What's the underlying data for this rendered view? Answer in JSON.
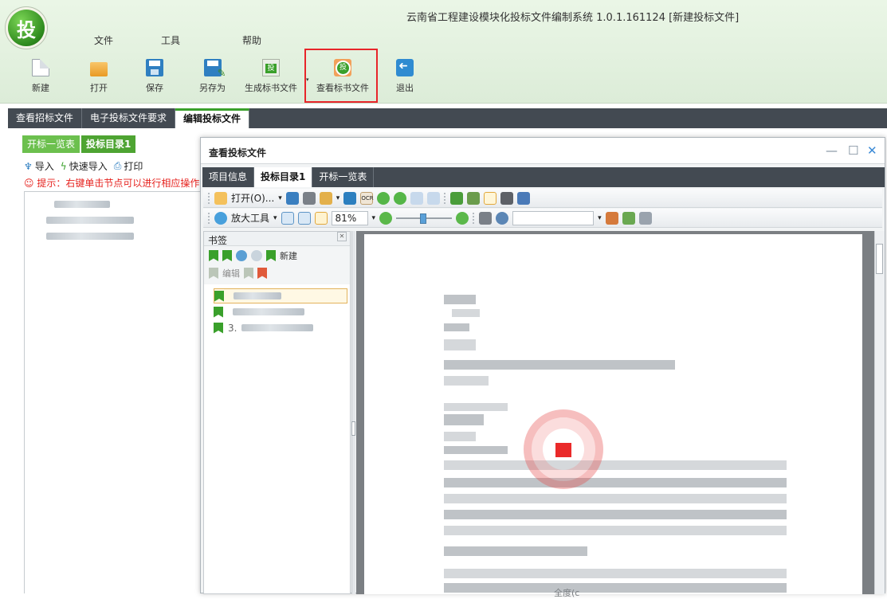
{
  "app": {
    "title": "云南省工程建设模块化投标文件编制系统 1.0.1.161124 [新建投标文件]",
    "logo_char": "投"
  },
  "menu": [
    "文件",
    "工具",
    "帮助"
  ],
  "toolbar": {
    "new": "新建",
    "open": "打开",
    "save": "保存",
    "save_as": "另存为",
    "generate": "生成标书文件",
    "view": "查看标书文件",
    "exit": "退出"
  },
  "main_tabs": [
    "查看招标文件",
    "电子投标文件要求",
    "编辑投标文件"
  ],
  "left_panel": {
    "sub_tabs": [
      "开标一览表",
      "投标目录1"
    ],
    "actions": {
      "import": "导入",
      "quick_import": "快速导入",
      "print": "打印"
    },
    "hint": "提示：右键单击节点可以进行相应操作"
  },
  "viewer": {
    "title": "查看投标文件",
    "tabs": [
      "项目信息",
      "投标目录1",
      "开标一览表"
    ],
    "toolbar1": {
      "open": "打开(O)..."
    },
    "toolbar2": {
      "zoom_tool": "放大工具",
      "zoom_value": "81%"
    },
    "bookmarks": {
      "title": "书签",
      "new": "新建",
      "edit": "编辑",
      "node_numbers": [
        "",
        "",
        "3."
      ]
    },
    "doc_caption": "全度(c"
  },
  "colors": {
    "accent_green": "#3aa02b",
    "tab_bar": "#434a52",
    "highlight": "#e8252a",
    "hint_red": "#e6231f"
  }
}
